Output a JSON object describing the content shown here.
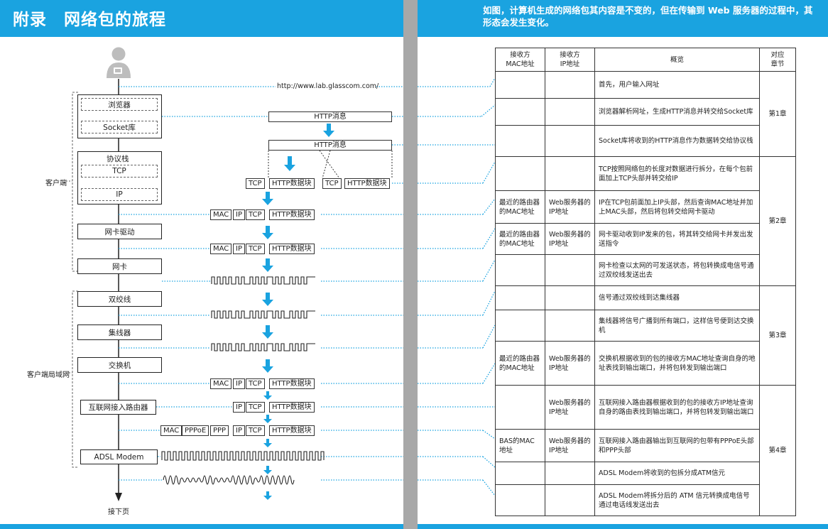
{
  "header": {
    "title": "附录　网络包的旅程",
    "subtitle": "如图，计算机生成的网络包其内容是不变的，但在传输到 Web 服务器的过程中，其形态会发生变化。"
  },
  "diagram": {
    "url": "http://www.lab.glasscom.com/",
    "boxes": {
      "browser": "浏览器",
      "socket": "Socket库",
      "protocol_stack": "协议栈",
      "tcp": "TCP",
      "ip": "IP",
      "nic_driver": "网卡驱动",
      "nic": "网卡",
      "twisted_pair": "双绞线",
      "hub": "集线器",
      "switch": "交换机",
      "router": "互联网接入路由器",
      "adsl": "ADSL Modem"
    },
    "group_labels": {
      "client": "客户端",
      "lan": "客户端局域网"
    },
    "segments": {
      "http_msg": "HTTP消息",
      "tcp": "TCP",
      "http_block": "HTTP数据块",
      "mac": "MAC",
      "ip": "IP",
      "pppoe": "PPPoE",
      "ppp": "PPP"
    },
    "next_page": "接下页"
  },
  "table": {
    "headers": [
      "接收方\nMAC地址",
      "接收方\nIP地址",
      "概览",
      "对应\n章节"
    ],
    "rows": [
      {
        "mac": "",
        "ip": "",
        "desc": "首先，用户输入网址"
      },
      {
        "mac": "",
        "ip": "",
        "desc": "浏览器解析网址，生成HTTP消息并转交给Socket库"
      },
      {
        "mac": "",
        "ip": "",
        "desc": "Socket库将收到的HTTP消息作为数据转交给协议栈"
      },
      {
        "mac": "",
        "ip": "",
        "desc": "TCP按照网络包的长度对数据进行拆分，在每个包前面加上TCP头部并转交给IP"
      },
      {
        "mac": "最近的路由器的MAC地址",
        "ip": "Web服务器的IP地址",
        "desc": "IP在TCP包前面加上IP头部，然后查询MAC地址并加上MAC头部，然后将包转交给网卡驱动"
      },
      {
        "mac": "最近的路由器的MAC地址",
        "ip": "Web服务器的IP地址",
        "desc": "网卡驱动收到IP发来的包，将其转交给网卡并发出发送指令"
      },
      {
        "mac": "",
        "ip": "",
        "desc": "网卡检查以太网的可发送状态，将包转换成电信号通过双绞线发送出去"
      },
      {
        "mac": "",
        "ip": "",
        "desc": "信号通过双绞线到达集线器"
      },
      {
        "mac": "",
        "ip": "",
        "desc": "集线器将信号广播到所有端口，这样信号便到达交换机"
      },
      {
        "mac": "最近的路由器的MAC地址",
        "ip": "Web服务器的IP地址",
        "desc": "交换机根据收到的包的接收方MAC地址查询自身的地址表找到输出端口，并将包转发到输出端口"
      },
      {
        "mac": "",
        "ip": "Web服务器的IP地址",
        "desc": "互联网接入路由器根据收到的包的接收方IP地址查询自身的路由表找到输出端口，并将包转发到输出端口"
      },
      {
        "mac": "BAS的MAC地址",
        "ip": "Web服务器的IP地址",
        "desc": "互联网接入路由器输出到互联网的包带有PPPoE头部和PPP头部"
      },
      {
        "mac": "",
        "ip": "",
        "desc": "ADSL Modem将收到的包拆分成ATM信元"
      },
      {
        "mac": "",
        "ip": "",
        "desc": "ADSL Modem将拆分后的 ATM 信元转换成电信号通过电话线发送出去"
      }
    ],
    "chapters": [
      "第1章",
      "第2章",
      "第3章",
      "第4章"
    ]
  },
  "colors": {
    "accent": "#1aa3e0",
    "dotted": "#1aa3e0",
    "spine": "#a8a8a8"
  }
}
